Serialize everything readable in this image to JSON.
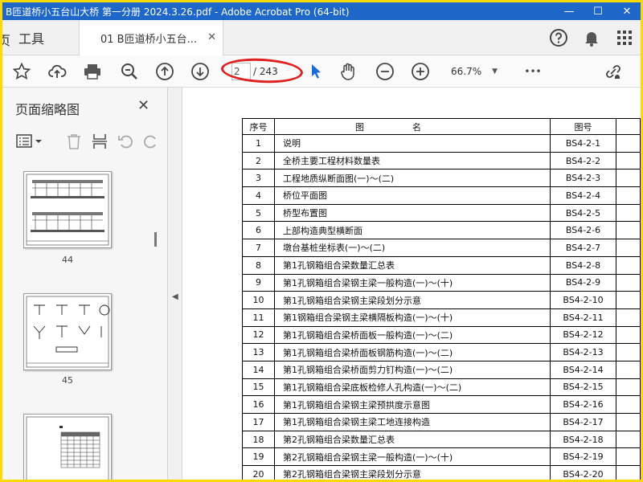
{
  "window": {
    "title": "B匝道桥小五台山大桥 第一分册 2024.3.26.pdf - Adobe Acrobat Pro (64-bit)",
    "minimize": "—",
    "maximize": "☐",
    "close": "✕"
  },
  "tabs": {
    "tools_label": "工具",
    "home_fragment": "页",
    "doc_tab_label": "01 B匝道桥小五台...",
    "doc_tab_close": "✕"
  },
  "toolbar": {
    "current_page": "2",
    "page_total": "/ 243",
    "zoom": "66.7%",
    "more": "•••"
  },
  "sidebar": {
    "title": "页面缩略图",
    "close": "✕",
    "thumbnails": [
      {
        "label": "44"
      },
      {
        "label": "45"
      },
      {
        "label": ""
      }
    ]
  },
  "document": {
    "headers": {
      "no": "序号",
      "name": "图名",
      "code": "图号"
    },
    "rows": [
      {
        "no": "1",
        "name": "说明",
        "code": "BS4-2-1"
      },
      {
        "no": "2",
        "name": "全桥主要工程材料数量表",
        "code": "BS4-2-2"
      },
      {
        "no": "3",
        "name": "工程地质纵断面图(一)～(二)",
        "code": "BS4-2-3"
      },
      {
        "no": "4",
        "name": "桥位平面图",
        "code": "BS4-2-4"
      },
      {
        "no": "5",
        "name": "桥型布置图",
        "code": "BS4-2-5"
      },
      {
        "no": "6",
        "name": "上部构造典型横断面",
        "code": "BS4-2-6"
      },
      {
        "no": "7",
        "name": "墩台基桩坐标表(一)～(二)",
        "code": "BS4-2-7"
      },
      {
        "no": "8",
        "name": "第1孔钢箱组合梁数量汇总表",
        "code": "BS4-2-8"
      },
      {
        "no": "9",
        "name": "第1孔钢箱组合梁钢主梁一般构造(一)～(十)",
        "code": "BS4-2-9"
      },
      {
        "no": "10",
        "name": "第1孔钢箱组合梁钢主梁段划分示意",
        "code": "BS4-2-10"
      },
      {
        "no": "11",
        "name": "第1钢箱组合梁钢主梁横隔板构造(一)～(十)",
        "code": "BS4-2-11"
      },
      {
        "no": "12",
        "name": "第1孔钢箱组合梁桥面板一般构造(一)～(二)",
        "code": "BS4-2-12"
      },
      {
        "no": "13",
        "name": "第1孔钢箱组合梁桥面板钢筋构造(一)～(二)",
        "code": "BS4-2-13"
      },
      {
        "no": "14",
        "name": "第1孔钢箱组合梁桥面剪力钉构造(一)～(二)",
        "code": "BS4-2-14"
      },
      {
        "no": "15",
        "name": "第1孔钢箱组合梁底板检修人孔构造(一)～(二)",
        "code": "BS4-2-15"
      },
      {
        "no": "16",
        "name": "第1孔钢箱组合梁钢主梁预拱度示意图",
        "code": "BS4-2-16"
      },
      {
        "no": "17",
        "name": "第1孔钢箱组合梁钢主梁工地连接构造",
        "code": "BS4-2-17"
      },
      {
        "no": "18",
        "name": "第2孔钢箱组合梁数量汇总表",
        "code": "BS4-2-18"
      },
      {
        "no": "19",
        "name": "第2孔钢箱组合梁钢主梁一般构造(一)～(十)",
        "code": "BS4-2-19"
      },
      {
        "no": "20",
        "name": "第2孔钢箱组合梁钢主梁段划分示意",
        "code": "BS4-2-20"
      }
    ]
  },
  "colors": {
    "title_bar": "#1e66c8",
    "frame_border": "#ffd800",
    "highlight_ring": "#e02020",
    "select_cursor": "#1a6bd8"
  }
}
